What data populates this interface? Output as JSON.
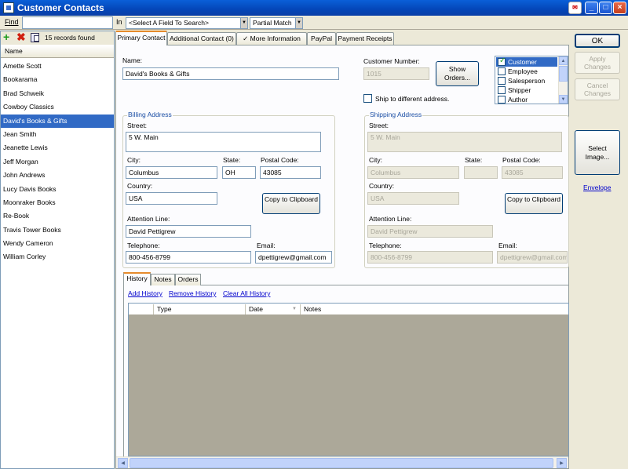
{
  "window": {
    "title": "Customer Contacts"
  },
  "toolbar": {
    "find_label": "Find",
    "in_label": "In",
    "search_field": "<Select A Field To Search>",
    "match_mode": "Partial Match"
  },
  "left": {
    "record_count": "15 records found",
    "column_header": "Name",
    "items": [
      "Amette Scott",
      "Bookarama",
      "Brad Schweik",
      "Cowboy Classics",
      "David's Books & Gifts",
      "Jean Smith",
      "Jeanette Lewis",
      "Jeff Morgan",
      "John Andrews",
      "Lucy Davis Books",
      "Moonraker Books",
      "Re-Book",
      "Travis Tower Books",
      "Wendy Cameron",
      "William Corley"
    ],
    "selected_index": 4
  },
  "tabs": [
    "Primary Contact",
    "Additional Contact (0)",
    "More Information",
    "PayPal",
    "Payment Receipts"
  ],
  "form": {
    "name_label": "Name:",
    "name_value": "David's Books & Gifts",
    "customer_number_label": "Customer Number:",
    "customer_number_value": "1015",
    "show_orders_button": "Show Orders...",
    "ship_different_label": "Ship to different address.",
    "roles": [
      {
        "label": "Customer",
        "checked": true
      },
      {
        "label": "Employee",
        "checked": false
      },
      {
        "label": "Salesperson",
        "checked": false
      },
      {
        "label": "Shipper",
        "checked": false
      },
      {
        "label": "Author",
        "checked": false
      }
    ],
    "billing": {
      "title": "Billing Address",
      "street_label": "Street:",
      "street": "5 W. Main",
      "city_label": "City:",
      "city": "Columbus",
      "state_label": "State:",
      "state": "OH",
      "postal_label": "Postal Code:",
      "postal": "43085",
      "country_label": "Country:",
      "country": "USA",
      "copy_button": "Copy to Clipboard",
      "attention_label": "Attention Line:",
      "attention": "David Pettigrew",
      "telephone_label": "Telephone:",
      "telephone": "800-456-8799",
      "email_label": "Email:",
      "email": "dpettigrew@gmail.com"
    },
    "shipping": {
      "title": "Shipping Address",
      "street_label": "Street:",
      "street": "5 W. Main",
      "city_label": "City:",
      "city": "Columbus",
      "state_label": "State:",
      "state": "",
      "postal_label": "Postal Code:",
      "postal": "43085",
      "country_label": "Country:",
      "country": "USA",
      "copy_button": "Copy to Clipboard",
      "attention_label": "Attention Line:",
      "attention": "David Pettigrew",
      "telephone_label": "Telephone:",
      "telephone": "800-456-8799",
      "email_label": "Email:",
      "email": "dpettigrew@gmail.com"
    }
  },
  "history": {
    "tabs": [
      "History",
      "Notes",
      "Orders"
    ],
    "links": [
      "Add History",
      "Remove History",
      "Clear All History"
    ],
    "columns": [
      "Type",
      "Date",
      "Notes"
    ]
  },
  "right": {
    "ok": "OK",
    "apply": "Apply Changes",
    "cancel": "Cancel Changes",
    "select_image": "Select Image...",
    "envelope": "Envelope"
  }
}
